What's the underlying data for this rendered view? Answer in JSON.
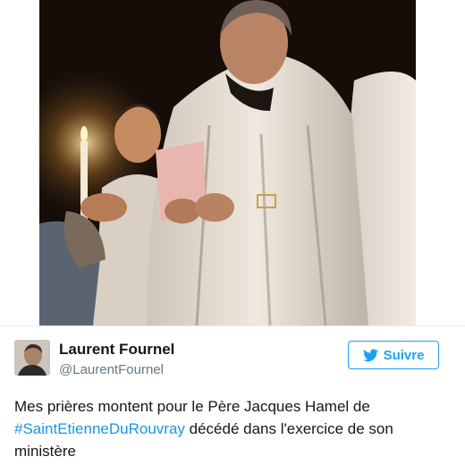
{
  "tweet": {
    "author": {
      "name": "Laurent Fournel",
      "handle": "@LaurentFournel",
      "avatar_icon": "profile-photo"
    },
    "follow_button": {
      "label": "Suivre",
      "icon": "twitter-bird-icon",
      "color": "#1da1f2"
    },
    "text": {
      "line1": "Mes prières montent pour le Père Jacques Hamel de",
      "hashtag": "#SaintEtienneDuRouvray",
      "line2_rest": " décédé dans l'exercice de son",
      "line3": "ministère"
    },
    "colors": {
      "name": "#14171a",
      "handle": "#657786",
      "hashtag": "#1b95e0",
      "accent": "#1da1f2"
    }
  }
}
